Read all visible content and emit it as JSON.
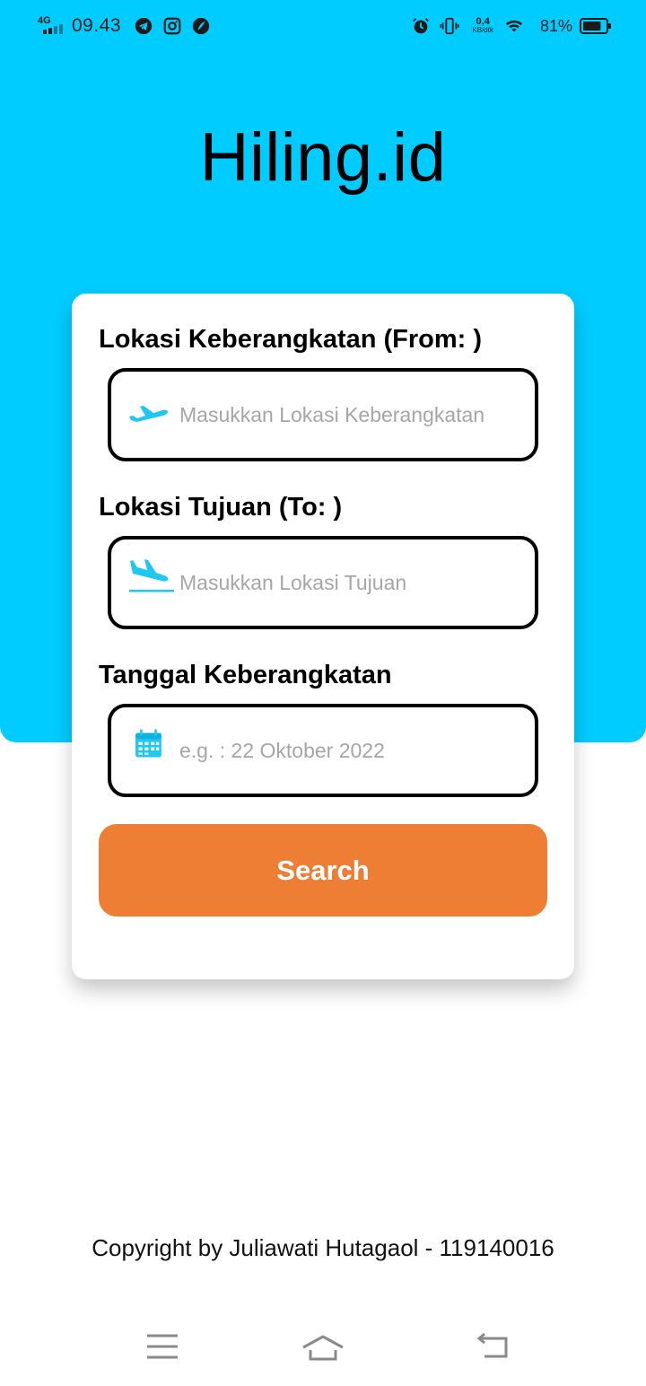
{
  "status_bar": {
    "network": "4G",
    "time": "09.43",
    "speed_value": "0,4",
    "speed_unit": "KB/dtk",
    "battery": "81%",
    "battery_level": 0.81,
    "icons": [
      "telegram-icon",
      "instagram-icon",
      "app-icon",
      "alarm-icon",
      "vibrate-icon",
      "wifi-icon",
      "battery-icon"
    ]
  },
  "app": {
    "title": "Hiling.id"
  },
  "form": {
    "from": {
      "label": "Lokasi Keberangkatan (From: )",
      "placeholder": "Masukkan Lokasi Keberangkatan",
      "value": "",
      "icon": "airplane-takeoff-icon"
    },
    "to": {
      "label": "Lokasi Tujuan (To: )",
      "placeholder": "Masukkan Lokasi Tujuan",
      "value": "",
      "icon": "airplane-landing-icon"
    },
    "date": {
      "label": "Tanggal Keberangkatan",
      "placeholder": "e.g. : 22 Oktober 2022",
      "value": "",
      "icon": "calendar-icon"
    },
    "search_label": "Search"
  },
  "footer": {
    "copyright": "Copyright by Juliawati Hutagaol - 119140016"
  },
  "nav_bar": {
    "items": [
      "menu-icon",
      "home-icon",
      "back-icon"
    ]
  },
  "colors": {
    "primary": "#00CCFF",
    "accent": "#EE7E33",
    "icon": "#1EC8F0",
    "card": "#FFFFFF"
  }
}
